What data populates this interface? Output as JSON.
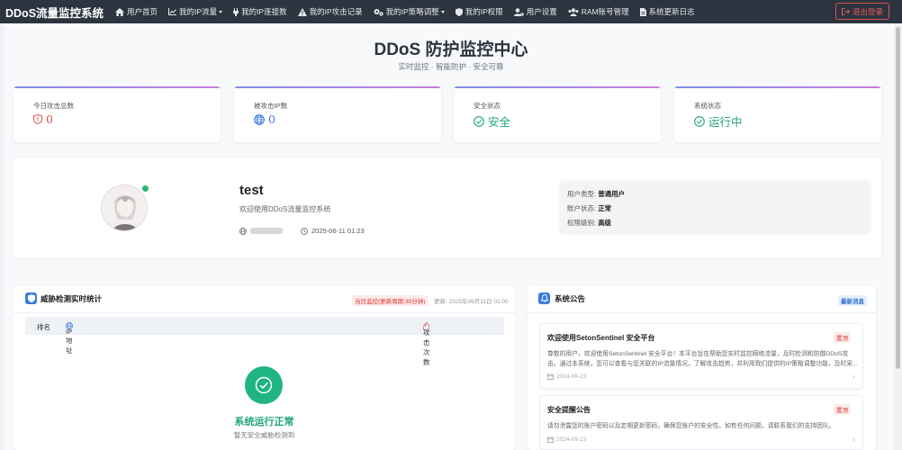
{
  "app": {
    "brand": "DDoS流量监控系统"
  },
  "nav": {
    "items": [
      {
        "label": "用户首页",
        "icon": "home-icon",
        "dropdown": false
      },
      {
        "label": "我的IP流量",
        "icon": "chart-line-icon",
        "dropdown": true
      },
      {
        "label": "我的IP连接数",
        "icon": "plug-icon",
        "dropdown": false
      },
      {
        "label": "我的IP攻击记录",
        "icon": "warning-icon",
        "dropdown": false
      },
      {
        "label": "我的IP策略调整",
        "icon": "gears-icon",
        "dropdown": true
      },
      {
        "label": "我的IP权限",
        "icon": "shield-icon",
        "dropdown": false
      },
      {
        "label": "用户设置",
        "icon": "user-gear-icon",
        "dropdown": false
      },
      {
        "label": "RAM账号管理",
        "icon": "users-icon",
        "dropdown": false
      },
      {
        "label": "系统更新日志",
        "icon": "file-icon",
        "dropdown": false
      }
    ],
    "logout_label": "退出登录"
  },
  "hero": {
    "title": "DDoS 防护监控中心",
    "subtitle": "实时监控 · 智能防护 · 安全可靠"
  },
  "stats": [
    {
      "label": "今日攻击总数",
      "value": "0",
      "color": "#d9534f",
      "icon": "shield-alert-icon"
    },
    {
      "label": "被攻击IP数",
      "value": "0",
      "color": "#3d7be0",
      "icon": "globe-icon"
    },
    {
      "label": "安全状态",
      "value": "安全",
      "color": "#1fa574",
      "icon": "check-circle-icon"
    },
    {
      "label": "系统状态",
      "value": "运行中",
      "color": "#1fa574",
      "icon": "check-circle-icon"
    }
  ],
  "profile": {
    "username": "test",
    "welcome": "欢迎使用DDoS流量监控系统",
    "login_time": "2025-06-11 01:23",
    "info": [
      {
        "label": "用户类型:",
        "value": "普通用户"
      },
      {
        "label": "账户状态:",
        "value": "正常"
      },
      {
        "label": "权限级别:",
        "value": "高级"
      }
    ]
  },
  "threat": {
    "title": "威胁检测实时统计",
    "badge": "当日监控(更新周期:30分钟)",
    "updated": "更新: 2025年06月11日 01:00",
    "columns": [
      "排名",
      "IP 地址",
      "攻击次数"
    ],
    "empty_title": "系统运行正常",
    "empty_sub": "暂无安全威胁检测到"
  },
  "announcements": {
    "title": "系统公告",
    "badge": "最新消息",
    "items": [
      {
        "title": "欢迎使用SetonSentinel 安全平台",
        "tag": "置顶",
        "body": "尊敬的用户，欢迎使用SetonSentinel 安全平台！本平台旨在帮助您实时监控网络流量，及时检测和防御DDoS攻击。通过本系统，您可以查看与您关联的IP流量情况，了解攻击趋势，并利用我们提供的IP策略调整功能，及时采...",
        "date": "2024-09-23"
      },
      {
        "title": "安全提醒公告",
        "tag": "置顶",
        "body": "请勿泄露您的账户密码以及定期更新密码，确保您账户的安全性。如有任何问题，请联系我们的支持团队。",
        "date": "2024-09-23"
      }
    ]
  }
}
